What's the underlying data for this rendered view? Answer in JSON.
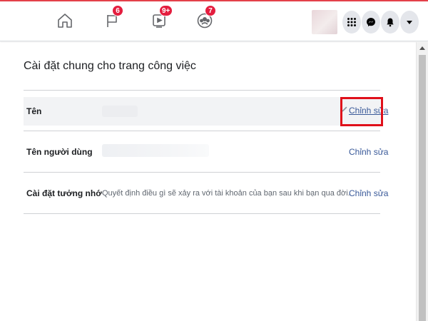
{
  "nav": {
    "badges": {
      "flag": "6",
      "watch": "9+",
      "groups": "7"
    },
    "icons": [
      "home-icon",
      "flag-icon",
      "watch-icon",
      "groups-icon",
      "menu-grid-icon",
      "messenger-icon",
      "notifications-bell-icon",
      "account-caret-icon"
    ]
  },
  "main": {
    "title": "Cài đặt chung cho trang công việc",
    "rows": [
      {
        "label": "Tên",
        "value": "",
        "edit": "Chỉnh sửa"
      },
      {
        "label": "Tên người dùng",
        "value": "",
        "edit": "Chỉnh sửa"
      },
      {
        "label": "Cài đặt tưởng nhớ",
        "value": "Quyết định điều gì sẽ xảy ra với tài khoản của bạn sau khi bạn qua đời.",
        "edit": "Chỉnh sửa"
      }
    ]
  },
  "colors": {
    "accent": "#e4404a",
    "link": "#385898",
    "highlight_box": "#e0101a",
    "badge": "#e41e3f"
  }
}
